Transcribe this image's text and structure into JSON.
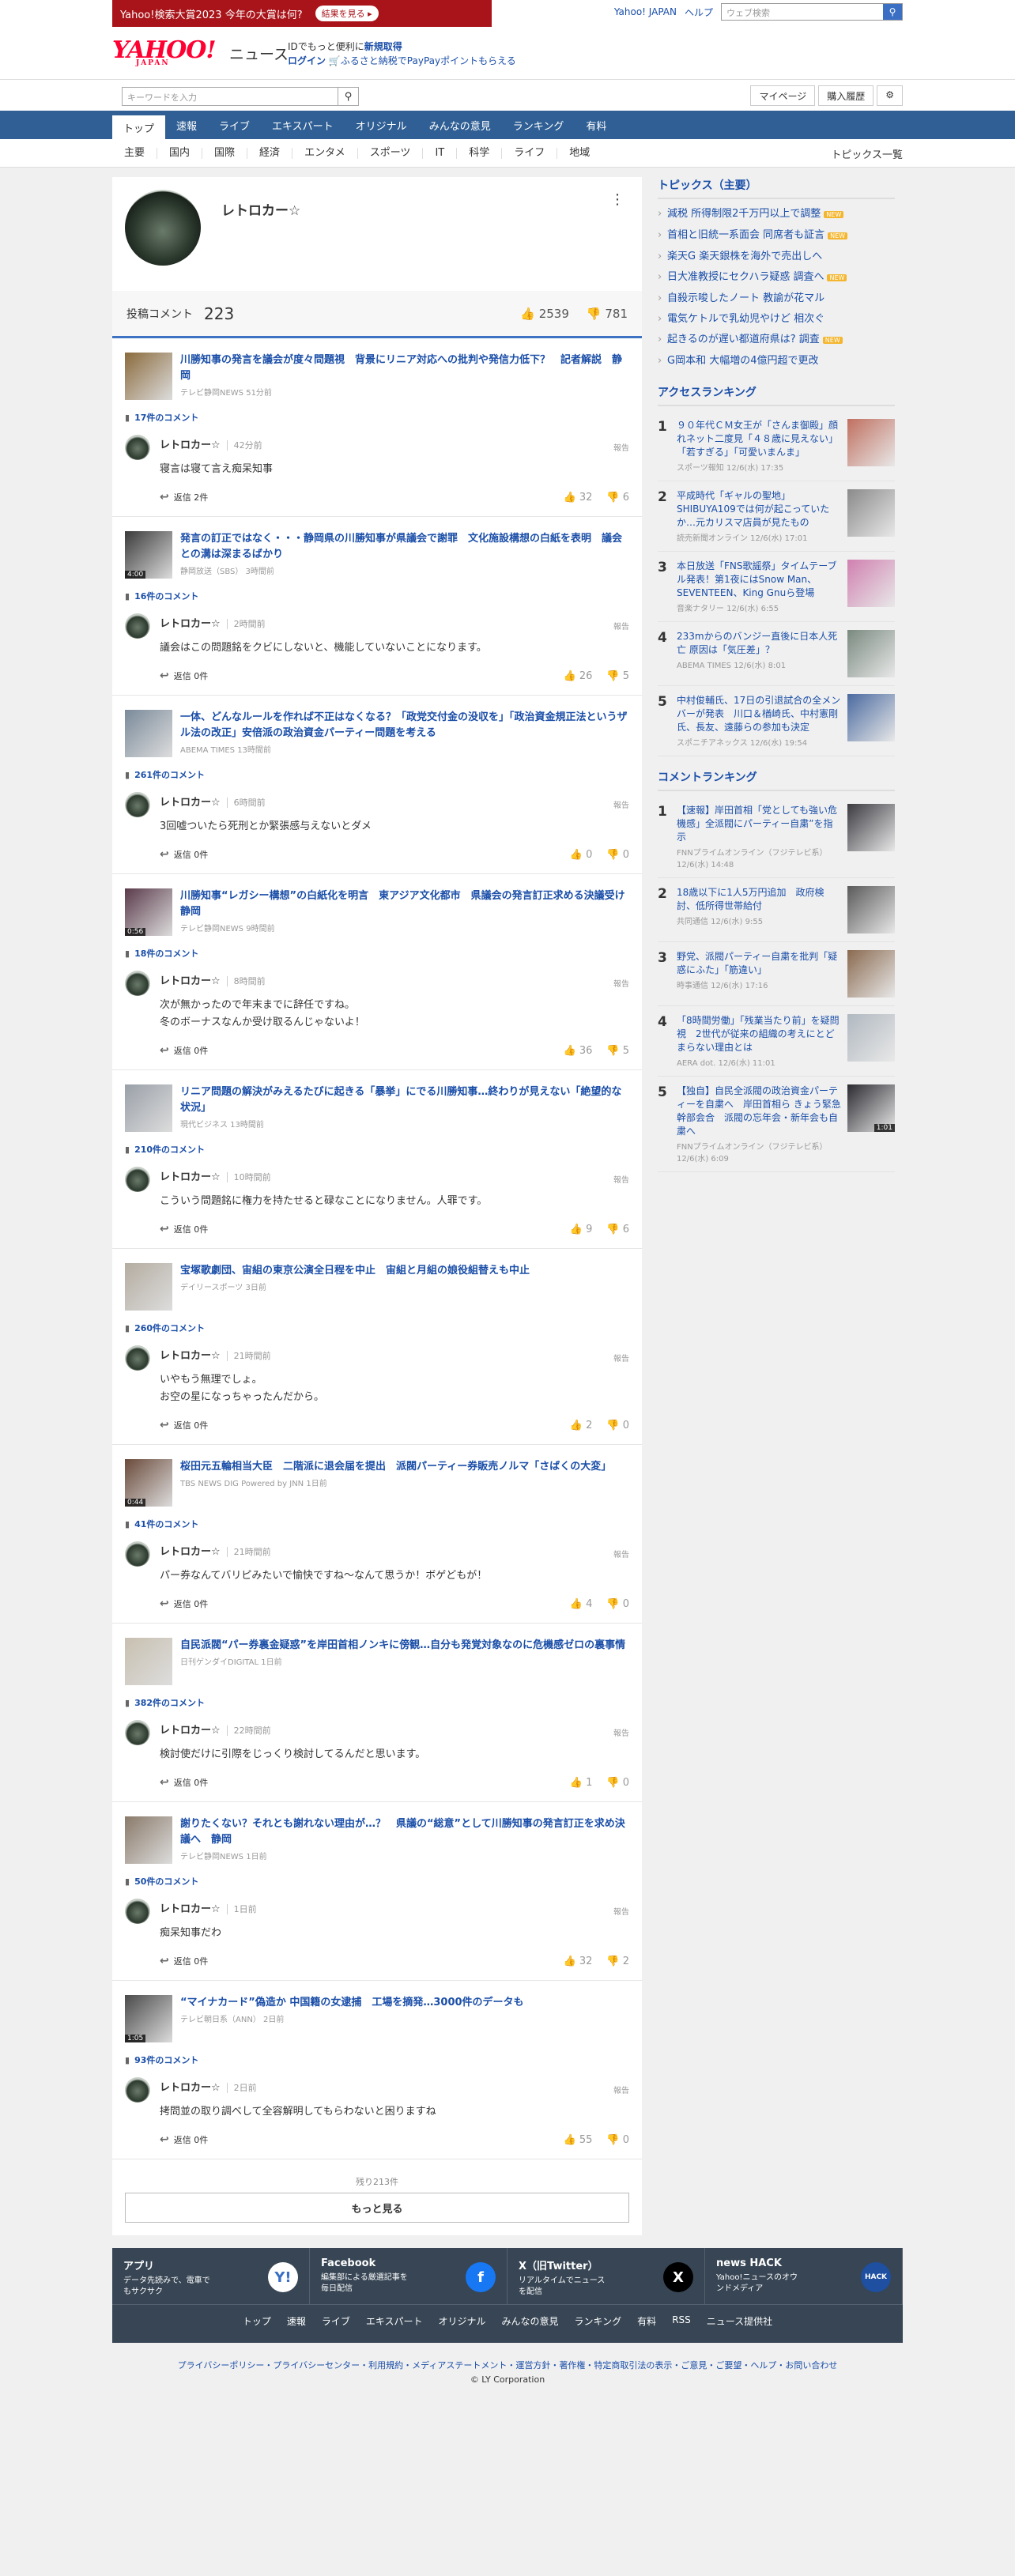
{
  "topbar": {
    "banner": "Yahoo!検索大賞2023 今年の大賞は何?",
    "banner_btn": "結果を見る ▸",
    "yahoo_japan": "Yahoo! JAPAN",
    "help": "ヘルプ",
    "search_placeholder": "ウェブ検索"
  },
  "header": {
    "logo": "YAHOO!",
    "logo_sub": "JAPAN",
    "news": "ニュース",
    "line1_prefix": "IDでもっと便利に",
    "line1_link": "新規取得",
    "line2_login": "ログイン",
    "line2_rest": "ふるさと納税でPayPayポイントもらえる"
  },
  "search": {
    "placeholder": "キーワードを入力",
    "mypage": "マイページ",
    "purchase": "購入履歴"
  },
  "gnav": [
    "トップ",
    "速報",
    "ライブ",
    "エキスパート",
    "オリジナル",
    "みんなの意見",
    "ランキング",
    "有料"
  ],
  "cnav": [
    "主要",
    "国内",
    "国際",
    "経済",
    "エンタメ",
    "スポーツ",
    "IT",
    "科学",
    "ライフ",
    "地域"
  ],
  "cnav_all": "トピックス一覧",
  "profile": {
    "name": "レトロカー☆",
    "menu": "⋮",
    "stats_label": "投稿コメント",
    "stats_count": "223",
    "likes": "2539",
    "dislikes": "781"
  },
  "articles": [
    {
      "title": "川勝知事の発言を議会が度々問題視　背景にリニア対応への批判や発信力低下？　記者解説　静岡",
      "source": "テレビ静岡NEWS 51分前",
      "video": "",
      "thumb": "#8a6a3c",
      "comments": "17件のコメント",
      "time": "42分前",
      "text": "寝言は寝て言え痴呆知事",
      "reply": "返信 2件",
      "like": "32",
      "dislike": "6"
    },
    {
      "title": "発言の訂正ではなく・・・静岡県の川勝知事が県議会で謝罪　文化施設構想の白紙を表明　議会との溝は深まるばかり",
      "source": "静岡放送（SBS） 3時間前",
      "video": "4:00",
      "thumb": "#3a3a3a",
      "comments": "16件のコメント",
      "time": "2時間前",
      "text": "議会はこの問題銘をクビにしないと、機能していないことになります。",
      "reply": "返信 0件",
      "like": "26",
      "dislike": "5"
    },
    {
      "title": "一体、どんなルールを作れば不正はなくなる？「政党交付金の没収を」「政治資金規正法というザル法の改正」安倍派の政治資金パーティー問題を考える",
      "source": "ABEMA TIMES 13時間前",
      "video": "",
      "thumb": "#7a8a9a",
      "comments": "261件のコメント",
      "time": "6時間前",
      "text": "3回嘘ついたら死刑とか緊張感与えないとダメ",
      "reply": "返信 0件",
      "like": "0",
      "dislike": "0"
    },
    {
      "title": "川勝知事“レガシー構想”の白紙化を明言　東アジア文化都市　県議会の発言訂正求める決議受け　静岡",
      "source": "テレビ静岡NEWS 9時間前",
      "video": "0:56",
      "thumb": "#5a3a4a",
      "comments": "18件のコメント",
      "time": "8時間前",
      "text": "次が無かったので年末までに辞任ですね。\n冬のボーナスなんか受け取るんじゃないよ！",
      "reply": "返信 0件",
      "like": "36",
      "dislike": "5"
    },
    {
      "title": "リニア問題の解決がみえるたびに起きる「暴挙」にでる川勝知事…終わりが見えない「絶望的な状況」",
      "source": "現代ビジネス 13時間前",
      "video": "",
      "thumb": "#9aa0a8",
      "comments": "210件のコメント",
      "time": "10時間前",
      "text": "こういう問題銘に権力を持たせると碌なことになりません。人罪です。",
      "reply": "返信 0件",
      "like": "9",
      "dislike": "6"
    },
    {
      "title": "宝塚歌劇団、宙組の東京公演全日程を中止　宙組と月組の娘役組替えも中止",
      "source": "デイリースポーツ 3日前",
      "video": "",
      "thumb": "#b4aca0",
      "comments": "260件のコメント",
      "time": "21時間前",
      "text": "いやもう無理でしょ。\nお空の星になっちゃったんだから。",
      "reply": "返信 0件",
      "like": "2",
      "dislike": "0"
    },
    {
      "title": "桜田元五輪相当大臣　二階派に退会届を提出　派閥パーティー券販売ノルマ「さばくの大変」",
      "source": "TBS NEWS DIG Powered by JNN 1日前",
      "video": "0:44",
      "thumb": "#6a4a3a",
      "comments": "41件のコメント",
      "time": "21時間前",
      "text": "パー券なんてバリピみたいで愉快ですね〜なんて思うか！ボゲどもが！",
      "reply": "返信 0件",
      "like": "4",
      "dislike": "0"
    },
    {
      "title": "自民派閥“パー券裏金疑惑”を岸田首相ノンキに傍観…自分も発覚対象なのに危機感ゼロの裏事情",
      "source": "日刊ゲンダイDIGITAL 1日前",
      "video": "",
      "thumb": "#c8c0b0",
      "comments": "382件のコメント",
      "time": "22時間前",
      "text": "検討使だけに引際をじっくり検討してるんだと思います。",
      "reply": "返信 0件",
      "like": "1",
      "dislike": "0"
    },
    {
      "title": "謝りたくない？それとも謝れない理由が…？　県議の“総意”として川勝知事の発言訂正を求め決議へ　静岡",
      "source": "テレビ静岡NEWS 1日前",
      "video": "",
      "thumb": "#8a7a6a",
      "comments": "50件のコメント",
      "time": "1日前",
      "text": "痴呆知事だわ",
      "reply": "返信 0件",
      "like": "32",
      "dislike": "2"
    },
    {
      "title": "“マイナカード”偽造か 中国籍の女逮捕　工場を摘発…3000件のデータも",
      "source": "テレビ朝日系（ANN） 2日前",
      "video": "1:05",
      "thumb": "#4a4a4a",
      "comments": "93件のコメント",
      "time": "2日前",
      "text": "拷問並の取り調べして全容解明してもらわないと困りますね",
      "reply": "返信 0件",
      "like": "55",
      "dislike": "0"
    }
  ],
  "more": {
    "remaining": "残り213件",
    "button": "もっと見る"
  },
  "report_label": "報告",
  "topics": {
    "heading": "トピックス（主要）",
    "items": [
      {
        "t": "減税 所得制限2千万円以上で調整",
        "n": "NEW"
      },
      {
        "t": "首相と旧統一系面会 同席者も証言",
        "n": "NEW"
      },
      {
        "t": "楽天G 楽天銀株を海外で売出しへ",
        "n": ""
      },
      {
        "t": "日大准教授にセクハラ疑惑 調査へ",
        "n": "NEW"
      },
      {
        "t": "自殺示唆したノート 教諭が花マル",
        "n": ""
      },
      {
        "t": "電気ケトルで乳幼児やけど 相次ぐ",
        "n": ""
      },
      {
        "t": "起きるのが遅い都道府県は? 調査",
        "n": "NEW"
      },
      {
        "t": "G岡本和 大幅増の4億円超で更改",
        "n": ""
      }
    ]
  },
  "access": {
    "heading": "アクセスランキング",
    "items": [
      {
        "no": "1",
        "t": "９０年代ＣＭ女王が「さんま御殿」顔れネット二度見「４８歳に見えない」「若すぎる」「可愛いまんま」",
        "s": "スポーツ報知 12/6(水) 17:35",
        "c": "#c07060",
        "v": ""
      },
      {
        "no": "2",
        "t": "平成時代「ギャルの聖地」SHIBUYA109では何が起こっていたか…元カリスマ店員が見たもの",
        "s": "読売新聞オンライン 12/6(水) 17:01",
        "c": "#8a8a8a",
        "v": ""
      },
      {
        "no": "3",
        "t": "本日放送「FNS歌謡祭」タイムテーブル発表！第1夜にはSnow Man、SEVENTEEN、King Gnuら登場",
        "s": "音楽ナタリー 12/6(水) 6:55",
        "c": "#d080b0",
        "v": ""
      },
      {
        "no": "4",
        "t": "233mからのバンジー直後に日本人死亡 原因は「気圧差」？",
        "s": "ABEMA TIMES 12/6(水) 8:01",
        "c": "#7a8a80",
        "v": ""
      },
      {
        "no": "5",
        "t": "中村俊輔氏、17日の引退試合の全メンバーが発表　川口＆楢崎氏、中村憲剛氏、長友、遠藤らの参加も決定",
        "s": "スポニチアネックス 12/6(水) 19:54",
        "c": "#4a6aa0",
        "v": ""
      }
    ]
  },
  "comment_rank": {
    "heading": "コメントランキング",
    "items": [
      {
        "no": "1",
        "t": "【速報】岸田首相「党としても強い危機感」全派閥にパーティー自粛”を指示",
        "s": "FNNプライムオンライン（フジテレビ系） 12/6(水) 14:48",
        "c": "#3a3a40",
        "v": ""
      },
      {
        "no": "2",
        "t": "18歳以下に1人5万円追加　政府検討、低所得世帯給付",
        "s": "共同通信 12/6(水) 9:55",
        "c": "#5a5a5a",
        "v": ""
      },
      {
        "no": "3",
        "t": "野党、派閥パーティー自粛を批判「疑惑にふた」「筋違い」",
        "s": "時事通信 12/6(水) 17:16",
        "c": "#8a6a50",
        "v": ""
      },
      {
        "no": "4",
        "t": "「8時間労働」「残業当たり前」を疑問視　2世代が従来の組織の考えにとどまらない理由とは",
        "s": "AERA dot. 12/6(水) 11:01",
        "c": "#b0b8c0",
        "v": ""
      },
      {
        "no": "5",
        "t": "【独自】自民全派閥の政治資金パーティーを自粛へ　岸田首相ら きょう緊急幹部会合　派閥の忘年会・新年会も自粛へ",
        "s": "FNNプライムオンライン（フジテレビ系） 12/6(水) 6:09",
        "c": "#2a2a30",
        "v": "1:01"
      }
    ]
  },
  "footer": {
    "cards": [
      {
        "t": "アプリ",
        "d": "データ先読みで、電車でもサクサク",
        "ic": "Y!",
        "bg": "#ffffff",
        "fg": "#3a6fc4"
      },
      {
        "t": "Facebook",
        "d": "編集部による厳選記事を毎日配信",
        "ic": "f",
        "bg": "#1877f2",
        "fg": "#ffffff"
      },
      {
        "t": "X（旧Twitter）",
        "d": "リアルタイムでニュースを配信",
        "ic": "X",
        "bg": "#000000",
        "fg": "#ffffff"
      },
      {
        "t": "news HACK",
        "d": "Yahoo!ニュースのオウンドメディア",
        "ic": "HACK",
        "bg": "#1e4fa0",
        "fg": "#ffffff"
      }
    ],
    "links": [
      "トップ",
      "速報",
      "ライブ",
      "エキスパート",
      "オリジナル",
      "みんなの意見",
      "ランキング",
      "有料",
      "RSS",
      "ニュース提供社"
    ],
    "legal": "プライバシーポリシー・プライバシーセンター・利用規約・メディアステートメント・運営方針・著作権・特定商取引法の表示・ご意見・ご要望・ヘルプ・お問い合わせ",
    "copy": "© LY Corporation"
  }
}
